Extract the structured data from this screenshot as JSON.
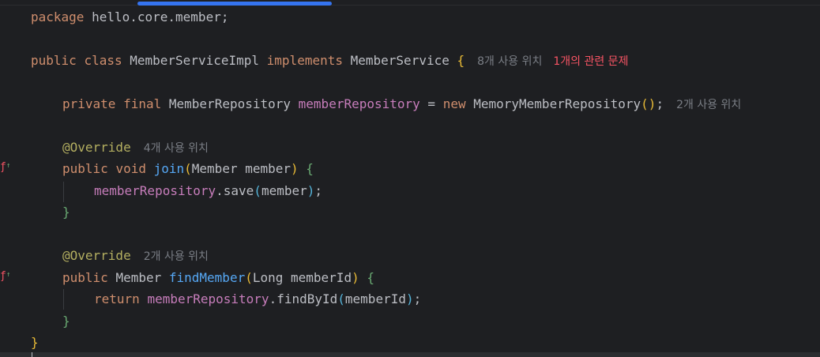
{
  "code": {
    "l1": {
      "kw": "package",
      "text": " hello.core.member;"
    },
    "l2": {
      "kw1": "public",
      "kw2": "class",
      "name": "MemberServiceImpl",
      "kw3": "implements",
      "iface": "MemberService",
      "brace": "{",
      "hint": "8개 사용 위치",
      "problem": "1개의 관련 문제"
    },
    "l3": {
      "kw1": "private",
      "kw2": "final",
      "type": "MemberRepository",
      "field": "memberRepository",
      "eq": " = ",
      "kw3": "new",
      "ctor": "MemoryMemberRepository",
      "open": "(",
      "close": ")",
      "semi": ";",
      "hint": "2개 사용 위치"
    },
    "l4": {
      "ann": "@Override",
      "hint": "4개 사용 위치"
    },
    "l5": {
      "kw1": "public",
      "kw2": "void",
      "fn": "join",
      "open": "(",
      "params": "Member member",
      "close": ")",
      "brace": "{"
    },
    "l6": {
      "field": "memberRepository",
      "call": ".save",
      "open": "(",
      "arg": "member",
      "close": ")",
      "semi": ";"
    },
    "l7": {
      "brace": "}"
    },
    "l8": {
      "ann": "@Override",
      "hint": "2개 사용 위치"
    },
    "l9": {
      "kw1": "public",
      "type": "Member",
      "fn": "findMember",
      "open": "(",
      "params": "Long memberId",
      "close": ")",
      "brace": "{"
    },
    "l10": {
      "kw": "return",
      "field": "memberRepository",
      "call": ".findById",
      "open": "(",
      "arg": "memberId",
      "close": ")",
      "semi": ";"
    },
    "l11": {
      "brace": "}"
    },
    "l12": {
      "brace": "}"
    }
  },
  "gutter": {
    "icon1": "implements-method-icon",
    "icon2": "implements-method-icon"
  }
}
